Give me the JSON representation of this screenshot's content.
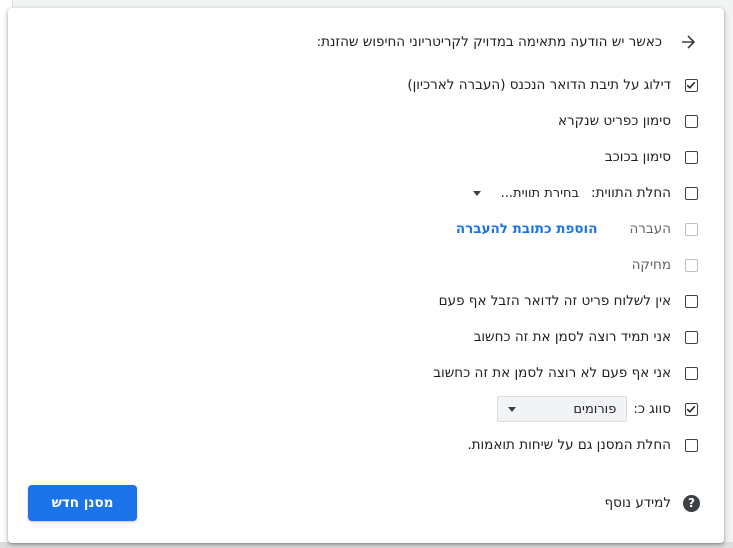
{
  "filter_dialog": {
    "header": "כאשר יש הודעה מתאימה במדויק לקריטריוני החיפוש שהזנת:",
    "options": [
      {
        "id": "skip_inbox",
        "label": "דילוג על תיבת הדואר הנכנס (העברה לארכיון)",
        "checked": true,
        "disabled": false
      },
      {
        "id": "mark_read",
        "label": "סימון כפריט שנקרא",
        "checked": false,
        "disabled": false
      },
      {
        "id": "star",
        "label": "סימון בכוכב",
        "checked": false,
        "disabled": false
      },
      {
        "id": "apply_label",
        "label": "החלת התווית:",
        "checked": false,
        "disabled": false
      },
      {
        "id": "forward",
        "label": "העברה",
        "checked": false,
        "disabled": true
      },
      {
        "id": "delete",
        "label": "מחיקה",
        "checked": false,
        "disabled": true
      },
      {
        "id": "never_spam",
        "label": "אין לשלוח פריט זה לדואר הזבל אף פעם",
        "checked": false,
        "disabled": false
      },
      {
        "id": "always_important",
        "label": "אני תמיד רוצה לסמן את זה כחשוב",
        "checked": false,
        "disabled": false
      },
      {
        "id": "never_important",
        "label": "אני אף פעם לא רוצה לסמן את זה כחשוב",
        "checked": false,
        "disabled": false
      },
      {
        "id": "categorize",
        "label": "סווג כ:",
        "checked": true,
        "disabled": false
      },
      {
        "id": "apply_to_matching",
        "label": "החלת המסנן גם על שיחות תואמות.",
        "checked": false,
        "disabled": false
      }
    ],
    "label_select": "בחירת תווית...",
    "forward_link": "הוספת כתובת להעברה",
    "category_select": "פורומים",
    "learn_more": "למידע נוסף",
    "create_button": "מסנן חדש"
  }
}
